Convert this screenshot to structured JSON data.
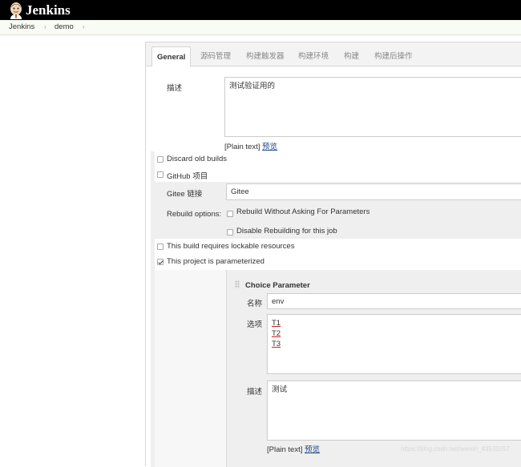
{
  "header": {
    "title": "Jenkins"
  },
  "breadcrumb": {
    "items": [
      "Jenkins",
      "demo"
    ],
    "separator": "›"
  },
  "tabs": [
    "General",
    "源码管理",
    "构建触发器",
    "构建环境",
    "构建",
    "构建后操作"
  ],
  "general": {
    "description_label": "描述",
    "description_value": "测试验证用的",
    "plain_text": "[Plain text]",
    "preview": "预览"
  },
  "options": {
    "discard_old_builds": "Discard old builds",
    "github_project": "GitHub 项目",
    "gitee_label": "Gitee 链接",
    "gitee_value": "Gitee",
    "rebuild_label": "Rebuild options:",
    "rebuild_without_asking": "Rebuild Without Asking For Parameters",
    "disable_rebuilding": "Disable Rebuilding for this job",
    "lockable_resources": "This build requires lockable resources",
    "parameterized": "This project is parameterized"
  },
  "choice_parameter": {
    "title": "Choice Parameter",
    "name_label": "名称",
    "name_value": "env",
    "choices_label": "选项",
    "choices": [
      "T1",
      "T2",
      "T3"
    ],
    "description_label": "描述",
    "description_value": "测试",
    "plain_text": "[Plain text]",
    "preview": "预览"
  },
  "watermark": "https://blog.csdn.net/weixin_43533257",
  "colors": {
    "topbar": "#000000",
    "link": "#204a87",
    "panel": "#f3f3f3"
  }
}
